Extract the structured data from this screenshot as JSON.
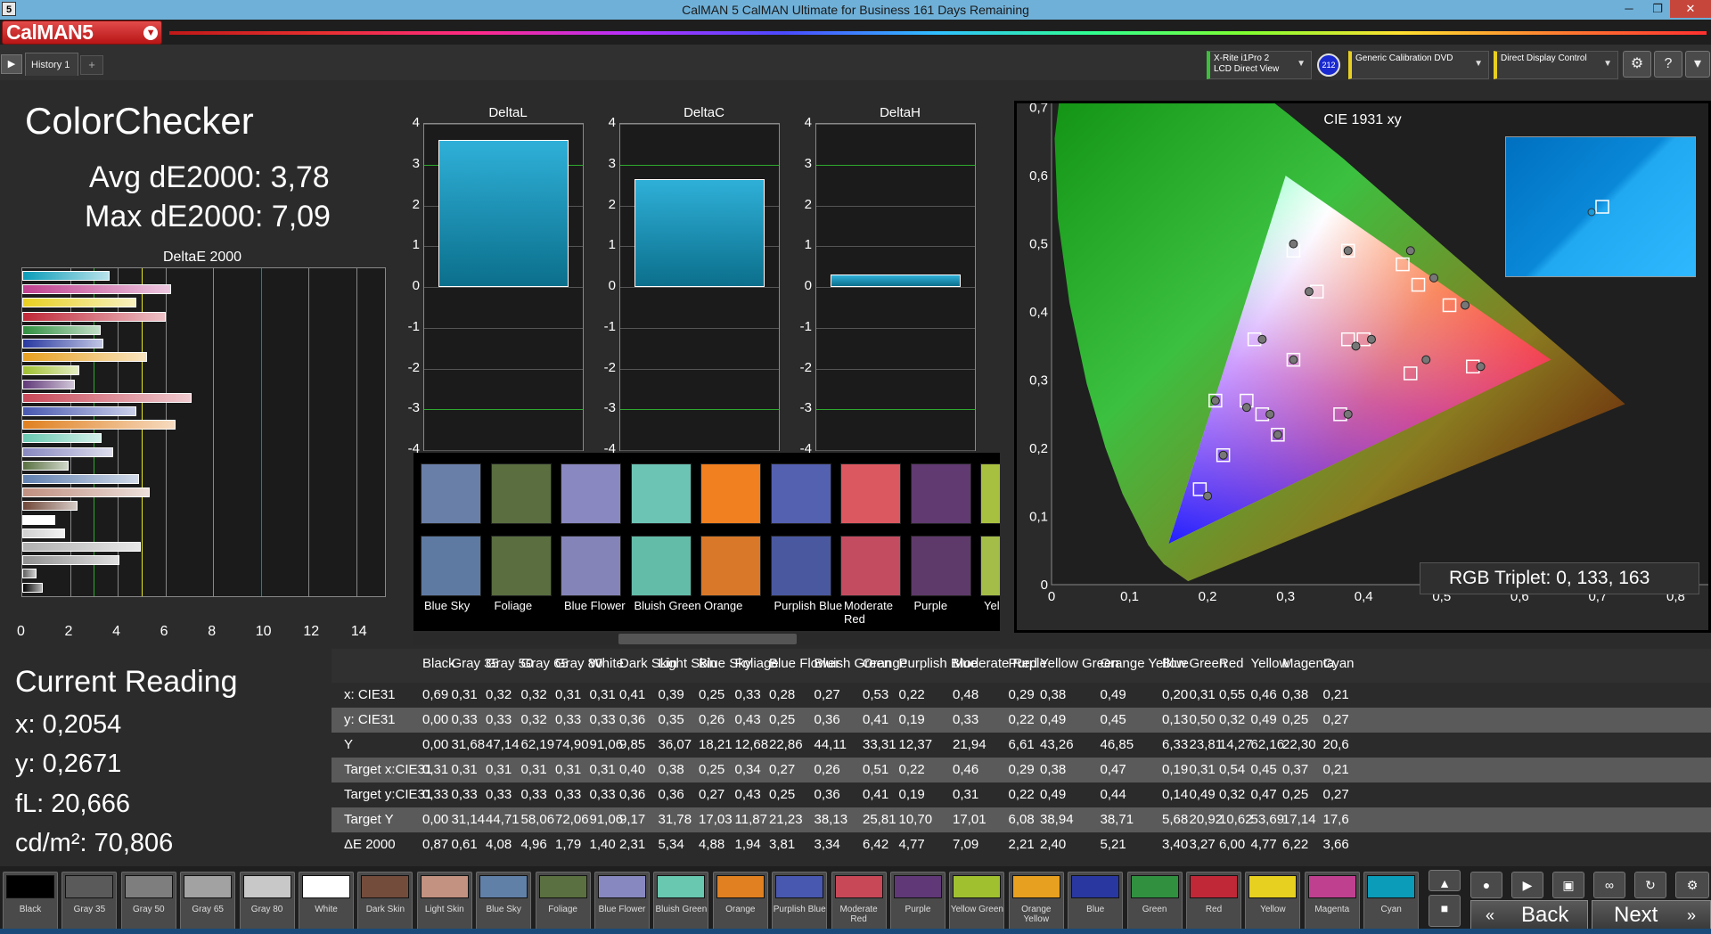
{
  "window": {
    "title": "CalMAN 5 CalMAN Ultimate for Business 161 Days Remaining",
    "app_icon": "5",
    "minimize": "─",
    "maximize": "❐",
    "close": "✕"
  },
  "logo": {
    "text": "CalMAN5"
  },
  "tabs": [
    {
      "label": "History 1"
    },
    {
      "label": "+"
    }
  ],
  "devices": {
    "meter": {
      "line1": "X-Rite i1Pro 2",
      "line2": "LCD Direct View"
    },
    "count": "212",
    "source": {
      "label": "Generic Calibration DVD"
    },
    "display": {
      "label": "Direct Display Control"
    }
  },
  "header": {
    "title": "ColorChecker",
    "avg": "Avg dE2000: 3,78",
    "max": "Max dE2000: 7,09"
  },
  "de_chart": {
    "title": "DeltaE 2000",
    "x_ticks": [
      "0",
      "2",
      "4",
      "6",
      "8",
      "10",
      "12",
      "14"
    ],
    "xlim": [
      0,
      15.2
    ],
    "thresholds": [
      {
        "value": 3,
        "color": "#2ea82e"
      },
      {
        "value": 5,
        "color": "#e8e820"
      },
      {
        "value": 10,
        "color": "#e03030"
      }
    ],
    "bars": [
      {
        "value": 3.66,
        "color": "#0a9cb8"
      },
      {
        "value": 6.22,
        "color": "#c04090"
      },
      {
        "value": 4.77,
        "color": "#e8d020"
      },
      {
        "value": 6.0,
        "color": "#c02838"
      },
      {
        "value": 3.27,
        "color": "#309040"
      },
      {
        "value": 3.4,
        "color": "#2838a0"
      },
      {
        "value": 5.21,
        "color": "#e8a020"
      },
      {
        "value": 2.4,
        "color": "#a0c030"
      },
      {
        "value": 2.21,
        "color": "#603878"
      },
      {
        "value": 7.09,
        "color": "#c84858"
      },
      {
        "value": 4.77,
        "color": "#4858b0"
      },
      {
        "value": 6.42,
        "color": "#e08020"
      },
      {
        "value": 3.34,
        "color": "#68c8b0"
      },
      {
        "value": 3.81,
        "color": "#8888c0"
      },
      {
        "value": 1.94,
        "color": "#587040"
      },
      {
        "value": 4.88,
        "color": "#6080b0"
      },
      {
        "value": 5.34,
        "color": "#c09080"
      },
      {
        "value": 2.31,
        "color": "#704838"
      },
      {
        "value": 1.4,
        "color": "#ffffff"
      },
      {
        "value": 1.79,
        "color": "#d0d0d0"
      },
      {
        "value": 4.96,
        "color": "#b0b0b0"
      },
      {
        "value": 4.08,
        "color": "#909090"
      },
      {
        "value": 0.61,
        "color": "#606060"
      },
      {
        "value": 0.87,
        "color": "#000000"
      }
    ]
  },
  "delta_charts": [
    {
      "title": "DeltaL",
      "value": 3.6
    },
    {
      "title": "DeltaC",
      "value": 2.65
    },
    {
      "title": "DeltaH",
      "value": 0.3
    }
  ],
  "delta_axis": {
    "ticks": [
      "4",
      "3",
      "2",
      "1",
      "0",
      "-1",
      "-2",
      "-3",
      "-4"
    ],
    "ylim": [
      -4,
      4
    ],
    "guides": [
      3,
      -3
    ]
  },
  "swatch_items": [
    {
      "label": "Blue Sky",
      "top": "#6a7fa8",
      "bottom": "#5e7aa2"
    },
    {
      "label": "Foliage",
      "top": "#5a6e40",
      "bottom": "#5a6e40"
    },
    {
      "label": "Blue Flower",
      "top": "#8a88c0",
      "bottom": "#8484b8"
    },
    {
      "label": "Bluish Green",
      "top": "#6cc4b4",
      "bottom": "#62bca8"
    },
    {
      "label": "Orange",
      "top": "#f08020",
      "bottom": "#d87828"
    },
    {
      "label": "Purplish Blue",
      "top": "#5460b0",
      "bottom": "#4a58a0"
    },
    {
      "label": "Moderate Red",
      "top": "#dc5860",
      "bottom": "#c44c60"
    },
    {
      "label": "Purple",
      "top": "#603a70",
      "bottom": "#5e3a6a"
    },
    {
      "label": "Yellow Green",
      "top": "#a8c040",
      "bottom": "#a4bc48"
    }
  ],
  "cie": {
    "title": "CIE 1931 xy",
    "x_ticks": [
      "0",
      "0,1",
      "0,2",
      "0,3",
      "0,4",
      "0,5",
      "0,6",
      "0,7",
      "0,8"
    ],
    "y_ticks": [
      "0",
      "0,1",
      "0,2",
      "0,3",
      "0,4",
      "0,5",
      "0,6",
      "0,7",
      "0,8"
    ],
    "gamut": {
      "red": [
        0.64,
        0.33
      ],
      "green": [
        0.3,
        0.6
      ],
      "blue": [
        0.15,
        0.06
      ]
    },
    "rgb_triplet": "RGB Triplet: 0, 133, 163",
    "targets": [
      [
        0.31,
        0.33
      ],
      [
        0.4,
        0.36
      ],
      [
        0.38,
        0.36
      ],
      [
        0.25,
        0.27
      ],
      [
        0.34,
        0.43
      ],
      [
        0.27,
        0.25
      ],
      [
        0.26,
        0.36
      ],
      [
        0.51,
        0.41
      ],
      [
        0.22,
        0.19
      ],
      [
        0.46,
        0.31
      ],
      [
        0.29,
        0.22
      ],
      [
        0.38,
        0.49
      ],
      [
        0.47,
        0.44
      ],
      [
        0.19,
        0.14
      ],
      [
        0.31,
        0.49
      ],
      [
        0.54,
        0.32
      ],
      [
        0.45,
        0.47
      ],
      [
        0.37,
        0.25
      ],
      [
        0.21,
        0.27
      ]
    ],
    "measured": [
      [
        0.31,
        0.33
      ],
      [
        0.41,
        0.36
      ],
      [
        0.39,
        0.35
      ],
      [
        0.25,
        0.26
      ],
      [
        0.33,
        0.43
      ],
      [
        0.28,
        0.25
      ],
      [
        0.27,
        0.36
      ],
      [
        0.53,
        0.41
      ],
      [
        0.22,
        0.19
      ],
      [
        0.48,
        0.33
      ],
      [
        0.29,
        0.22
      ],
      [
        0.38,
        0.49
      ],
      [
        0.49,
        0.45
      ],
      [
        0.2,
        0.13
      ],
      [
        0.31,
        0.5
      ],
      [
        0.55,
        0.32
      ],
      [
        0.46,
        0.49
      ],
      [
        0.38,
        0.25
      ],
      [
        0.21,
        0.27
      ]
    ]
  },
  "current_reading": {
    "title": "Current Reading",
    "x": "x: 0,2054",
    "y": "y: 0,2671",
    "fl": "fL: 20,666",
    "cdm2": "cd/m²: 70,806"
  },
  "table": {
    "columns": [
      "Black",
      "Gray 35",
      "Gray 50",
      "Gray 65",
      "Gray 80",
      "White",
      "Dark Skin",
      "Light Skin",
      "Blue Sky",
      "Foliage",
      "Blue Flower",
      "Bluish Green",
      "Orange",
      "Purplish Blue",
      "Moderate Red",
      "Purple",
      "Yellow Green",
      "Orange Yellow",
      "Blue",
      "Green",
      "Red",
      "Yellow",
      "Magenta",
      "Cyan"
    ],
    "rows": [
      {
        "label": "x: CIE31",
        "values": [
          "0,69",
          "0,31",
          "0,32",
          "0,32",
          "0,31",
          "0,31",
          "0,41",
          "0,39",
          "0,25",
          "0,33",
          "0,28",
          "0,27",
          "0,53",
          "0,22",
          "0,48",
          "0,29",
          "0,38",
          "0,49",
          "0,20",
          "0,31",
          "0,55",
          "0,46",
          "0,38",
          "0,21"
        ]
      },
      {
        "label": "y: CIE31",
        "values": [
          "0,00",
          "0,33",
          "0,33",
          "0,32",
          "0,33",
          "0,33",
          "0,36",
          "0,35",
          "0,26",
          "0,43",
          "0,25",
          "0,36",
          "0,41",
          "0,19",
          "0,33",
          "0,22",
          "0,49",
          "0,45",
          "0,13",
          "0,50",
          "0,32",
          "0,49",
          "0,25",
          "0,27"
        ]
      },
      {
        "label": "Y",
        "values": [
          "0,00",
          "31,68",
          "47,14",
          "62,19",
          "74,90",
          "91,06",
          "9,85",
          "36,07",
          "18,21",
          "12,68",
          "22,86",
          "44,11",
          "33,31",
          "12,37",
          "21,94",
          "6,61",
          "43,26",
          "46,85",
          "6,33",
          "23,81",
          "14,27",
          "62,16",
          "22,30",
          "20,6"
        ]
      },
      {
        "label": "Target x:CIE31",
        "values": [
          "0,31",
          "0,31",
          "0,31",
          "0,31",
          "0,31",
          "0,31",
          "0,40",
          "0,38",
          "0,25",
          "0,34",
          "0,27",
          "0,26",
          "0,51",
          "0,22",
          "0,46",
          "0,29",
          "0,38",
          "0,47",
          "0,19",
          "0,31",
          "0,54",
          "0,45",
          "0,37",
          "0,21"
        ]
      },
      {
        "label": "Target y:CIE31",
        "values": [
          "0,33",
          "0,33",
          "0,33",
          "0,33",
          "0,33",
          "0,33",
          "0,36",
          "0,36",
          "0,27",
          "0,43",
          "0,25",
          "0,36",
          "0,41",
          "0,19",
          "0,31",
          "0,22",
          "0,49",
          "0,44",
          "0,14",
          "0,49",
          "0,32",
          "0,47",
          "0,25",
          "0,27"
        ]
      },
      {
        "label": "Target Y",
        "values": [
          "0,00",
          "31,14",
          "44,71",
          "58,06",
          "72,06",
          "91,06",
          "9,17",
          "31,78",
          "17,03",
          "11,87",
          "21,23",
          "38,13",
          "25,81",
          "10,70",
          "17,01",
          "6,08",
          "38,94",
          "38,71",
          "5,68",
          "20,92",
          "10,62",
          "53,69",
          "17,14",
          "17,6"
        ]
      },
      {
        "label": "ΔE 2000",
        "values": [
          "0,87",
          "0,61",
          "4,08",
          "4,96",
          "1,79",
          "1,40",
          "2,31",
          "5,34",
          "4,88",
          "1,94",
          "3,81",
          "3,34",
          "6,42",
          "4,77",
          "7,09",
          "2,21",
          "2,40",
          "5,21",
          "3,40",
          "3,27",
          "6,00",
          "4,77",
          "6,22",
          "3,66"
        ]
      }
    ]
  },
  "patches": [
    {
      "label": "Black",
      "color": "#000000"
    },
    {
      "label": "Gray 35",
      "color": "#5a5a5a"
    },
    {
      "label": "Gray 50",
      "color": "#7e7e7e"
    },
    {
      "label": "Gray 65",
      "color": "#a2a2a2"
    },
    {
      "label": "Gray 80",
      "color": "#c8c8c8"
    },
    {
      "label": "White",
      "color": "#ffffff"
    },
    {
      "label": "Dark Skin",
      "color": "#734c3c"
    },
    {
      "label": "Light Skin",
      "color": "#c49280"
    },
    {
      "label": "Blue Sky",
      "color": "#6080a8"
    },
    {
      "label": "Foliage",
      "color": "#5a7040"
    },
    {
      "label": "Blue Flower",
      "color": "#8888c0"
    },
    {
      "label": "Bluish Green",
      "color": "#68c8b0"
    },
    {
      "label": "Orange",
      "color": "#e08020"
    },
    {
      "label": "Purplish Blue",
      "color": "#4858b0"
    },
    {
      "label": "Moderate Red",
      "color": "#c84858"
    },
    {
      "label": "Purple",
      "color": "#603878"
    },
    {
      "label": "Yellow Green",
      "color": "#a0c030"
    },
    {
      "label": "Orange Yellow",
      "color": "#e8a020"
    },
    {
      "label": "Blue",
      "color": "#2838a0"
    },
    {
      "label": "Green",
      "color": "#309040"
    },
    {
      "label": "Red",
      "color": "#c02838"
    },
    {
      "label": "Yellow",
      "color": "#e8d020"
    },
    {
      "label": "Magenta",
      "color": "#c04090"
    },
    {
      "label": "Cyan",
      "color": "#0a9cb8"
    }
  ],
  "controls": {
    "back": "Back",
    "next": "Next"
  }
}
